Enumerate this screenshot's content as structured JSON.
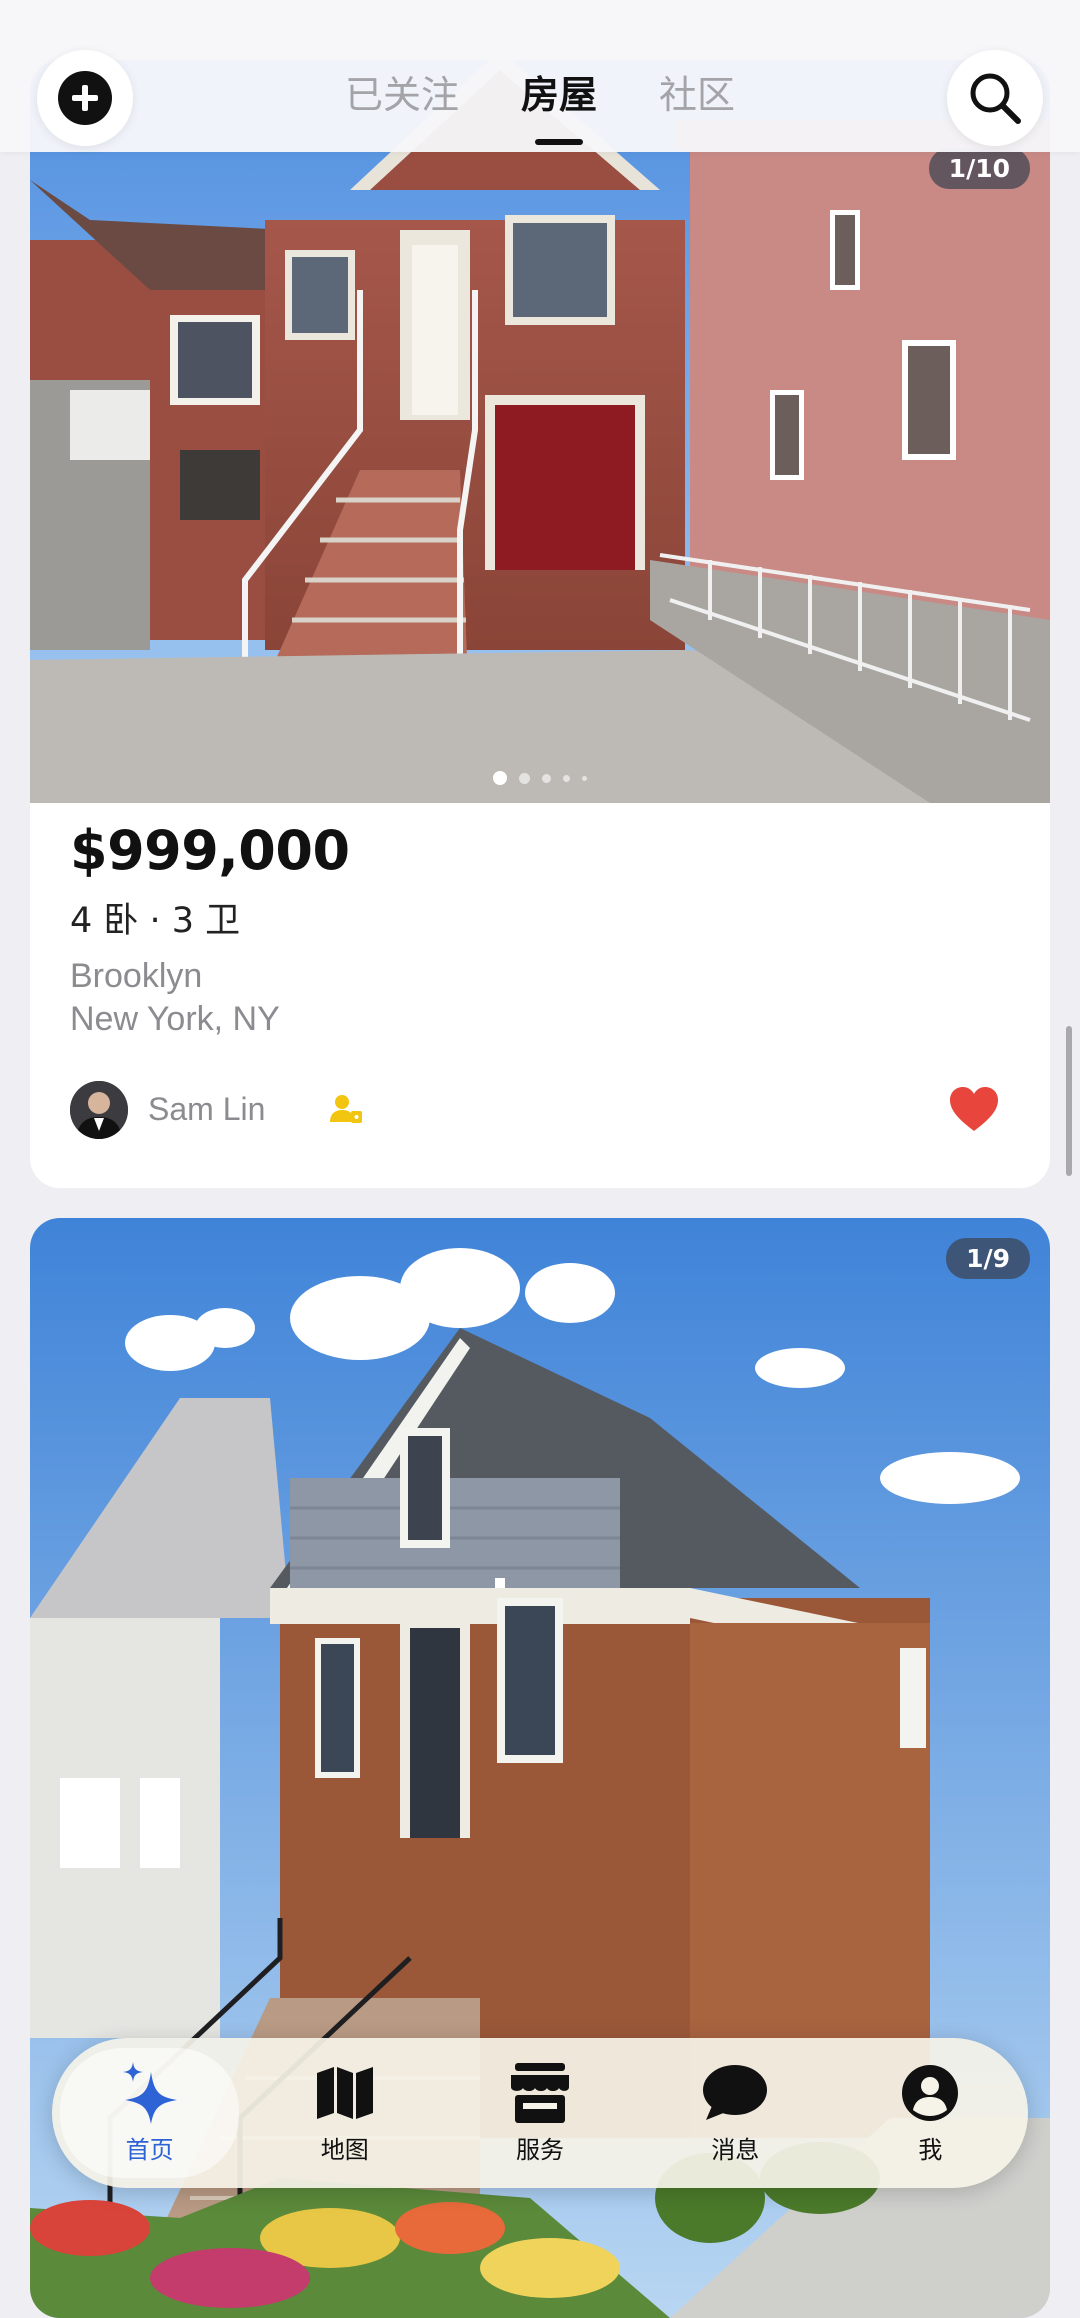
{
  "header": {
    "tabs": [
      {
        "label": "已关注",
        "active": false
      },
      {
        "label": "房屋",
        "active": true
      },
      {
        "label": "社区",
        "active": false
      }
    ],
    "add_icon": "plus-circle-icon",
    "search_icon": "search-icon"
  },
  "listings": [
    {
      "photo_counter": "1/10",
      "price": "$999,000",
      "rooms": "4 卧 · 3 卫",
      "area": "Brooklyn",
      "city": "New York, NY",
      "agent_name": "Sam Lin",
      "favorited": true
    },
    {
      "photo_counter": "1/9"
    }
  ],
  "bottom_nav": [
    {
      "label": "首页",
      "icon": "sparkle-icon",
      "active": true
    },
    {
      "label": "地图",
      "icon": "map-icon",
      "active": false
    },
    {
      "label": "服务",
      "icon": "store-icon",
      "active": false
    },
    {
      "label": "消息",
      "icon": "chat-bubble-icon",
      "active": false
    },
    {
      "label": "我",
      "icon": "profile-icon",
      "active": false
    }
  ],
  "colors": {
    "accent": "#2e63d6",
    "favorite": "#e8463d",
    "agent_badge": "#f2c511"
  }
}
